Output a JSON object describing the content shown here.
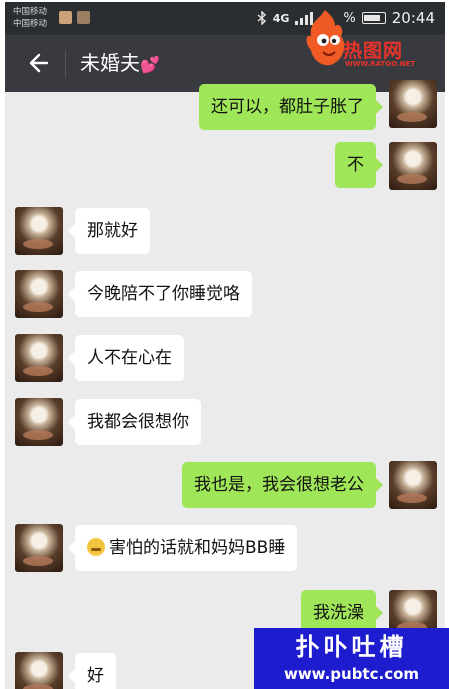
{
  "status_bar": {
    "carrier_1": "中国移动",
    "carrier_2": "中国移动",
    "network": "4G",
    "battery_text": "%",
    "time": "20:44"
  },
  "header": {
    "back_icon": "back-arrow-icon",
    "title": "未婚夫",
    "title_emoji": "💕"
  },
  "logo": {
    "text": "热图网",
    "url": "WWW.RATOO.NET"
  },
  "messages": [
    {
      "side": "right",
      "text": "还可以，都肚子胀了"
    },
    {
      "side": "right",
      "text": "不"
    },
    {
      "side": "left",
      "text": "那就好"
    },
    {
      "side": "left",
      "text": "今晚陪不了你睡觉咯"
    },
    {
      "side": "left",
      "text": "人不在心在"
    },
    {
      "side": "left",
      "text": "我都会很想你"
    },
    {
      "side": "right",
      "text": "我也是，我会很想老公"
    },
    {
      "side": "left",
      "text": "害怕的话就和妈妈BB睡",
      "emoji": "thinking-face-emoji"
    },
    {
      "side": "right",
      "text": "我洗澡"
    },
    {
      "side": "left",
      "text": "好"
    }
  ],
  "watermark": {
    "title": "扑卟吐槽",
    "url": "www.pubtc.com"
  },
  "colors": {
    "title_bar": "#393a3f",
    "chat_background": "#ebebeb",
    "sent_bubble": "#9fe658",
    "received_bubble": "#ffffff",
    "watermark_bg": "#1d1dcf"
  }
}
